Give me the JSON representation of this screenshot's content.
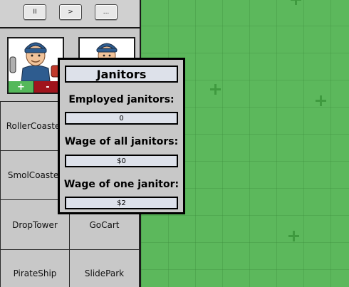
{
  "toolbar": {
    "pause_label": "II",
    "play_label": ">",
    "more_label": "..."
  },
  "workers": {
    "add_label": "+",
    "remove_label": "-"
  },
  "rides": [
    {
      "label": "RollerCoaster"
    },
    {
      "label": "SmolCoaster"
    },
    {
      "label": "DropTower"
    },
    {
      "label": "GoCart"
    },
    {
      "label": "PirateShip"
    },
    {
      "label": "SlidePark"
    }
  ],
  "janitors_popup": {
    "title": "Janitors",
    "employed_label": "Employed janitors:",
    "employed_value": "0",
    "wage_all_label": "Wage of all janitors:",
    "wage_all_value": "$0",
    "wage_one_label": "Wage of one janitor:",
    "wage_one_value": "$2"
  },
  "colors": {
    "grass": "#5cb85c",
    "panel": "#c8c8c8",
    "add_button": "#54b85a",
    "remove_button": "#a0141c",
    "field_bg": "#dde1ea"
  }
}
